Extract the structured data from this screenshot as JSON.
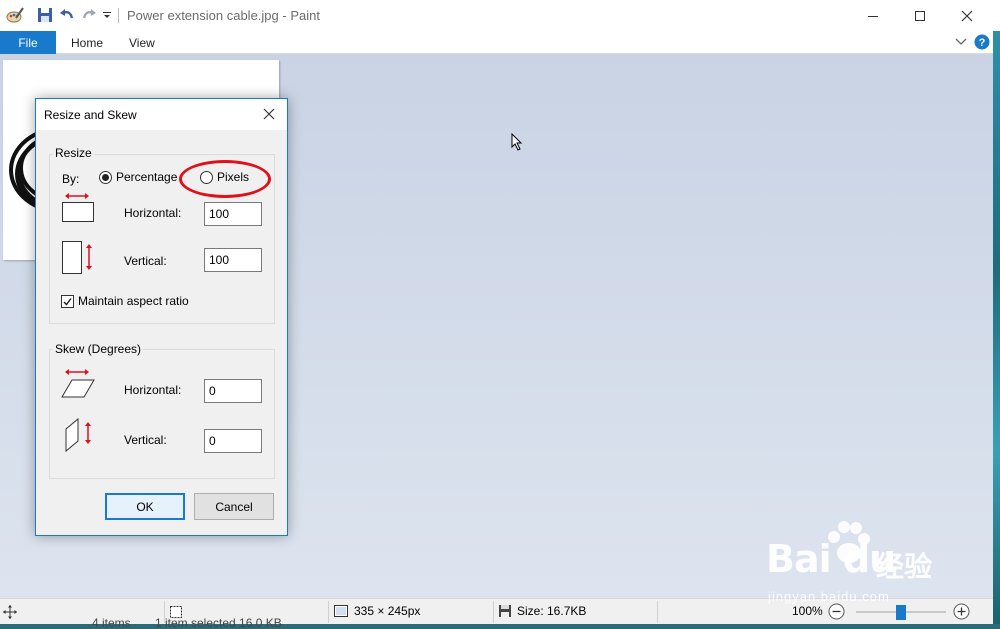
{
  "window": {
    "title": "Power extension cable.jpg - Paint"
  },
  "ribbon": {
    "tabs": [
      "File",
      "Home",
      "View"
    ]
  },
  "dialog": {
    "title": "Resize and Skew",
    "resize": {
      "legend": "Resize",
      "by_label": "By:",
      "option_percentage": "Percentage",
      "option_pixels": "Pixels",
      "selected": "Percentage",
      "horizontal_label": "Horizontal:",
      "horizontal_value": "100",
      "vertical_label": "Vertical:",
      "vertical_value": "100",
      "maintain_aspect_label": "Maintain aspect ratio",
      "maintain_aspect_checked": true
    },
    "skew": {
      "legend": "Skew (Degrees)",
      "horizontal_label": "Horizontal:",
      "horizontal_value": "0",
      "vertical_label": "Vertical:",
      "vertical_value": "0"
    },
    "ok_label": "OK",
    "cancel_label": "Cancel"
  },
  "statusbar": {
    "dimensions": "335 × 245px",
    "size": "Size: 16.7KB",
    "zoom": "100%",
    "zoom_level": 0.5
  },
  "background_text": {
    "items": "4 items",
    "selected": "1 item selected  16.0 KB"
  },
  "watermark": {
    "brand": "Bai du",
    "cn": "经验",
    "url": "jingyan.baidu.com"
  },
  "colors": {
    "accent": "#1979ca",
    "annotation": "#e0101a"
  }
}
